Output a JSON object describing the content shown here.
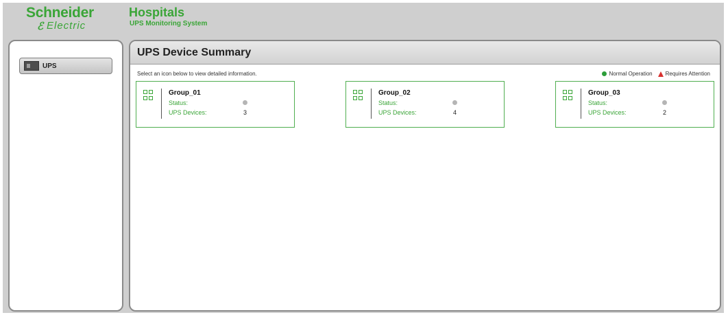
{
  "header": {
    "logo_line1": "Schneider",
    "logo_line2": "Electric",
    "app_title": "Hospitals",
    "app_subtitle": "UPS Monitoring System"
  },
  "sidebar": {
    "items": [
      {
        "label": "UPS",
        "icon": "ups-device-icon"
      }
    ]
  },
  "main": {
    "title": "UPS Device Summary",
    "instructions": "Select an icon below to view detailed information.",
    "legend": {
      "normal": "Normal Operation",
      "attention": "Requires Attention",
      "normal_color": "#2d9e3a",
      "attention_color": "#d8312f"
    },
    "status_label": "Status:",
    "devices_label": "UPS Devices:",
    "groups": [
      {
        "name": "Group_01",
        "ups_devices": "3",
        "status_color": "#b5b5b5"
      },
      {
        "name": "Group_02",
        "ups_devices": "4",
        "status_color": "#b5b5b5"
      },
      {
        "name": "Group_03",
        "ups_devices": "2",
        "status_color": "#b5b5b5"
      }
    ]
  },
  "colors": {
    "brand_green": "#3aa537",
    "frame_gray": "#cfcfcf"
  }
}
